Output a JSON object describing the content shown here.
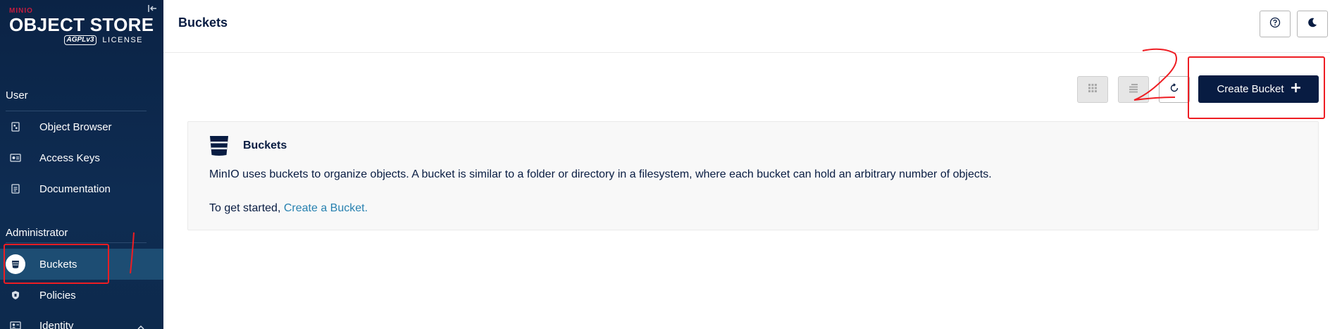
{
  "app": {
    "brand_small": "MINIO",
    "brand_main": "OBJECT STORE",
    "license_badge": "AGPLv3",
    "license_label": "LICENSE"
  },
  "sidebar": {
    "user_section": "User",
    "user_items": [
      {
        "label": "Object Browser",
        "icon": "object-browser-icon"
      },
      {
        "label": "Access Keys",
        "icon": "access-keys-icon"
      },
      {
        "label": "Documentation",
        "icon": "documentation-icon"
      }
    ],
    "admin_section": "Administrator",
    "admin_items": [
      {
        "label": "Buckets",
        "icon": "bucket-icon",
        "active": true
      },
      {
        "label": "Policies",
        "icon": "policies-icon"
      },
      {
        "label": "Identity",
        "icon": "identity-icon"
      }
    ]
  },
  "header": {
    "title": "Buckets"
  },
  "toolbar": {
    "create_label": "Create Bucket"
  },
  "info": {
    "title": "Buckets",
    "description": "MinIO uses buckets to organize objects. A bucket is similar to a folder or directory in a filesystem, where each bucket can hold an arbitrary number of objects.",
    "start_prefix": "To get started,",
    "start_link": "Create a Bucket."
  },
  "annotations": {
    "color": "#ee1d23",
    "mark_1": "1",
    "mark_2": "2"
  },
  "colors": {
    "sidebar_bg": "#0d2b4e",
    "active_item": "#1d4d73",
    "primary_button": "#081c42",
    "link": "#2781b0"
  }
}
